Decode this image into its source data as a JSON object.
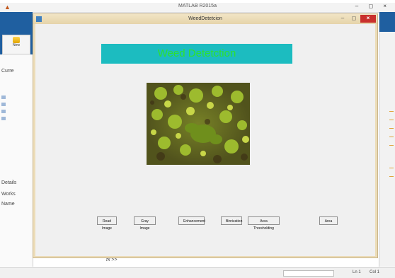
{
  "matlab": {
    "title": "MATLAB R2015a",
    "toolstrip_new_label": "New",
    "left_panel_labels": [
      "Curre",
      "Details",
      "Works",
      "Name"
    ],
    "command_prompt": ">>",
    "status": {
      "ln": "Ln 1",
      "col": "Col 1"
    }
  },
  "figure": {
    "title": "WeedDetetcion",
    "banner": "Weed Detetction",
    "buttons": [
      "Read Image",
      "Gray Image",
      "Enhancement",
      "Binrization",
      "Area Thresholding",
      "Area"
    ]
  },
  "colors": {
    "banner_bg": "#1cbcc0",
    "banner_text": "#2ee12e",
    "figure_frame": "#ecdcb8",
    "close_button": "#c9302c",
    "matlab_blue": "#1f5fa0"
  }
}
